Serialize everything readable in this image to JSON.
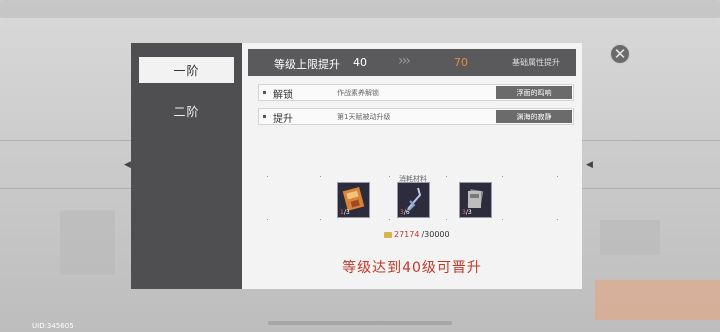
{
  "tiers": {
    "items": [
      {
        "label": "一阶",
        "active": true
      },
      {
        "label": "二阶",
        "active": false
      }
    ]
  },
  "header": {
    "title": "等级上限提升",
    "from_level": "40",
    "arrows": "›››",
    "to_level": "70",
    "base_attr_label": "基础属性提升"
  },
  "rows": [
    {
      "label": "解锁",
      "desc": "作战素养解锁",
      "value": "浮面的鸣响"
    },
    {
      "label": "提升",
      "desc": "第1天赋被动升级",
      "value": "渊海的寂静"
    }
  ],
  "materials": {
    "label": "消耗材料",
    "items": [
      {
        "icon": "material-icon-orange",
        "count_need": "1",
        "count_total": "/3"
      },
      {
        "icon": "material-icon-crystal",
        "count_need": "3",
        "count_total": "/6"
      },
      {
        "icon": "material-icon-cards",
        "count_need": "3",
        "count_total": "/3"
      }
    ],
    "gold_have": "27174",
    "gold_total": "/30000"
  },
  "requirement": "等级达到40级可晋升",
  "uid": "UID:345605",
  "colors": {
    "accent_orange": "#e88a3a",
    "warning_red": "#c0392b",
    "panel_dark": "#4f4f51"
  }
}
